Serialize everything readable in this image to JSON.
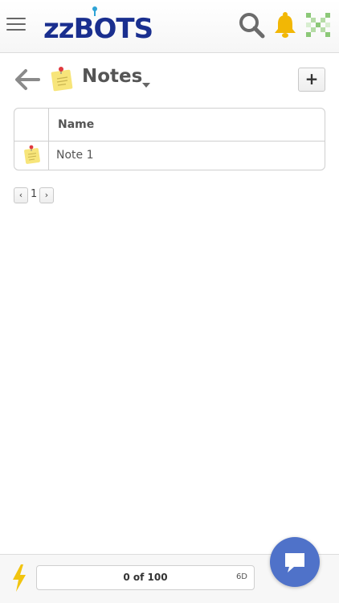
{
  "header": {
    "logo_text": "zzBOTS",
    "icons": [
      "menu-icon",
      "search-icon",
      "bell-icon",
      "pixel-grid-icon"
    ]
  },
  "page": {
    "title": "Notes",
    "add_label": "+"
  },
  "table": {
    "columns": [
      "Name"
    ],
    "rows": [
      {
        "name": "Note 1",
        "icon": "note-icon"
      }
    ]
  },
  "pagination": {
    "prev": "‹",
    "current": "1",
    "next": "›"
  },
  "footer": {
    "progress_text": "0 of 100",
    "progress_fraction": 0,
    "progress_tag": "6D"
  },
  "colors": {
    "brand": "#1a2f8f",
    "accent_blue": "#4f72c9",
    "bell_yellow": "#f2b705",
    "pixel_green": "#8cc878",
    "bolt_yellow": "#f1c40f"
  }
}
